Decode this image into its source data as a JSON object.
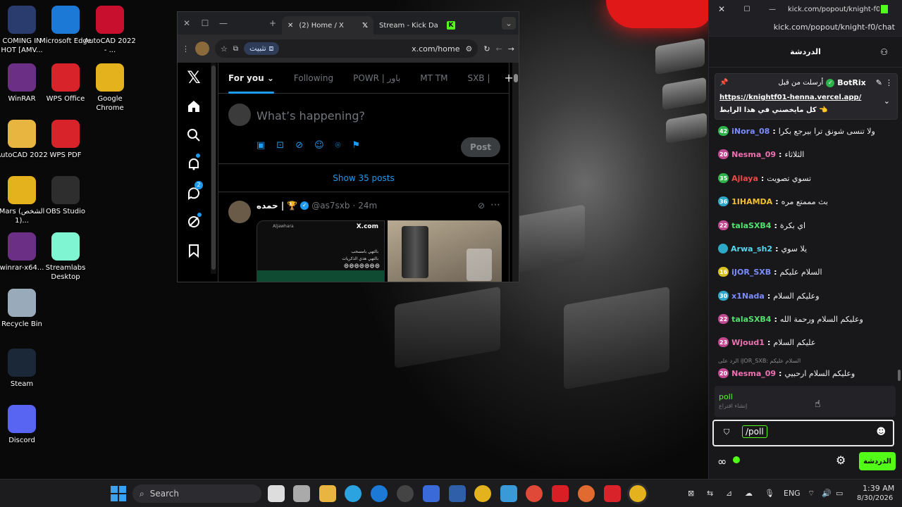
{
  "desktop": {
    "icons": [
      {
        "label": "COMING IN HOT [AMV...",
        "icon": "video-file-icon",
        "color": "#2a3b6e"
      },
      {
        "label": "Microsoft Edge",
        "icon": "edge-icon",
        "color": "#1c7ad6"
      },
      {
        "label": "AutoCAD 2022 - ...",
        "icon": "autocad-icon",
        "color": "#c8102e"
      },
      {
        "label": "WinRAR",
        "icon": "winrar-icon",
        "color": "#6b2f86"
      },
      {
        "label": "WPS Office",
        "icon": "wps-office-icon",
        "color": "#d8232a"
      },
      {
        "label": "Google Chrome",
        "icon": "chrome-icon",
        "color": "#e4b21c"
      },
      {
        "label": "AutoCAD 2022",
        "icon": "folder-icon",
        "color": "#e8b640"
      },
      {
        "label": "WPS PDF",
        "icon": "wps-pdf-icon",
        "color": "#d8232a"
      },
      {
        "label": "Mars (الشخص 1)...",
        "icon": "chrome-icon",
        "color": "#e4b21c"
      },
      {
        "label": "OBS Studio",
        "icon": "obs-icon",
        "color": "#2e2e2e"
      },
      {
        "label": "winrar-x64...",
        "icon": "winrar-icon",
        "color": "#6b2f86"
      },
      {
        "label": "Streamlabs Desktop",
        "icon": "streamlabs-icon",
        "color": "#80f5d2"
      },
      {
        "label": "Recycle Bin",
        "icon": "recycle-bin-icon",
        "color": "#9ab"
      },
      {
        "label": "Steam",
        "icon": "steam-icon",
        "color": "#1b2838"
      },
      {
        "label": "Discord",
        "icon": "discord-icon",
        "color": "#5865f2"
      }
    ]
  },
  "browser": {
    "tabs": [
      {
        "label": "(2) Home / X"
      },
      {
        "label": "Stream - Kick Da"
      }
    ],
    "pin_label": "تثبيت",
    "url": "x.com/home",
    "x": {
      "tabs": [
        {
          "label": "For you"
        },
        {
          "label": "Following"
        },
        {
          "label": "POWR | باور"
        },
        {
          "label": "MT TM"
        },
        {
          "label": "SXB |"
        }
      ],
      "compose_placeholder": "What’s happening?",
      "post_button": "Post",
      "show_posts": "Show 35 posts",
      "tweet": {
        "name": "حمده |",
        "handle": "@as7sxb",
        "time": "24m",
        "embed_line1": "بالتهي بامسحب",
        "embed_line2": "بالتهي هذي الذكريات",
        "embed_emojis": "😄😄😄😄😄😄😄",
        "embed_brand": "X.com",
        "embed_user": "Aljawhara"
      }
    }
  },
  "chat": {
    "window_title": "kick.com/popout/knight-f0/c...",
    "url": "kick.com/popout/knight-f0/chat",
    "header_title": "الدردشة",
    "pinned": {
      "sent_by_label": "أرسلت من قبل",
      "user": "BotRix",
      "link": "https://knightf01-henna.vercel.app/",
      "text": "كل مايخصني في هذا الرابط 👈"
    },
    "messages": [
      {
        "badge": "42",
        "badge_color": "#2eb34a",
        "user": "iNora_08",
        "color": "#7b8cff",
        "text": "ولا تنسى شونق ترا بيرجع بكرا"
      },
      {
        "badge": "20",
        "badge_color": "#c04890",
        "user": "Nesma_09",
        "color": "#f070b0",
        "text": "الثلاثاء"
      },
      {
        "badge": "35",
        "badge_color": "#2eb34a",
        "user": "Ajlaya",
        "color": "#f04848",
        "text": "تسوي تصويت"
      },
      {
        "badge": "36",
        "badge_color": "#2ea8c8",
        "user": "1IHAMDA",
        "color": "#f0c030",
        "text": "بث مممتع مره"
      },
      {
        "badge": "22",
        "badge_color": "#c04890",
        "user": "talaSXB4",
        "color": "#53e070",
        "text": "اي بكرة"
      },
      {
        "badge": "",
        "badge_color": "#2ea8c8",
        "user": "Arwa_sh2",
        "color": "#53d8f0",
        "text": "يلا سوي"
      },
      {
        "badge": "16",
        "badge_color": "#d8c020",
        "user": "iJOR_SXB",
        "color": "#7b8cff",
        "text": "السلام عليكم"
      },
      {
        "badge": "30",
        "badge_color": "#2ea8c8",
        "user": "x1Nada",
        "color": "#7b8cff",
        "text": "وعليكم السلام"
      },
      {
        "badge": "22",
        "badge_color": "#c04890",
        "user": "talaSXB4",
        "color": "#53e070",
        "text": "وعليكم السلام ورحمة الله"
      },
      {
        "badge": "23",
        "badge_color": "#c04890",
        "user": "Wjoud1",
        "color": "#f070b0",
        "text": "عليكم السلام"
      },
      {
        "badge": "20",
        "badge_color": "#c04890",
        "user": "Nesma_09",
        "color": "#f070b0",
        "text": "وعليكم السلام ارحبيي"
      }
    ],
    "reply_hint": "الرد على iJOR_SXB: السلام عليكم",
    "poll": {
      "command": "poll",
      "description": "إنشاء اقتراع"
    },
    "input_value": "/poll",
    "send_label": "الدردشة"
  },
  "taskbar": {
    "search_placeholder": "Search",
    "lang": "ENG",
    "time": "1:39 AM",
    "date": "8/30/2026"
  }
}
